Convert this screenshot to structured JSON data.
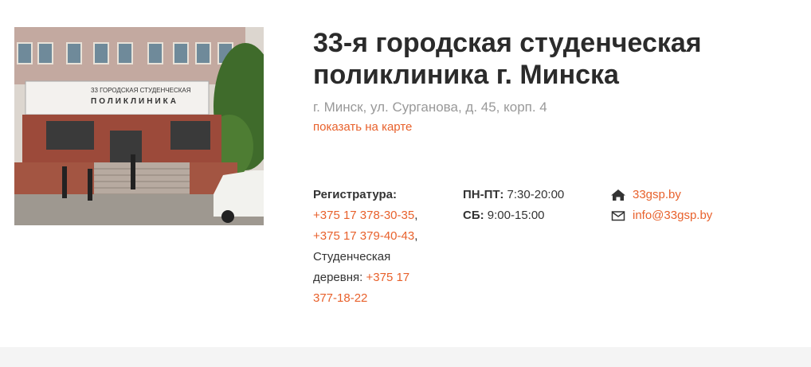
{
  "clinic": {
    "name": "33-я городская студенческая поликлиника г. Минска",
    "address": "г. Минск, ул. Сурганова, д. 45, корп. 4",
    "map_link": "показать на карте"
  },
  "photo": {
    "sign_line1": "33 ГОРОДСКАЯ СТУДЕНЧЕСКАЯ",
    "sign_line2": "ПОЛИКЛИНИКА"
  },
  "registry": {
    "label": "Регистратура:",
    "phone1": "+375 17 378-30-35",
    "phone2": "+375 17 379-40-43",
    "sep": ",",
    "village_label": "Студенческая деревня:",
    "phone3": "+375 17 377-18-22"
  },
  "hours": {
    "weekdays_label": "ПН-ПТ:",
    "weekdays_value": "7:30-20:00",
    "saturday_label": "СБ:",
    "saturday_value": "9:00-15:00"
  },
  "contacts": {
    "site_icon": "home-icon",
    "site": "33gsp.by",
    "email_icon": "envelope-icon",
    "email": "info@33gsp.by"
  },
  "colors": {
    "accent": "#e8612c",
    "muted": "#999999",
    "title": "#2b2b2b"
  }
}
